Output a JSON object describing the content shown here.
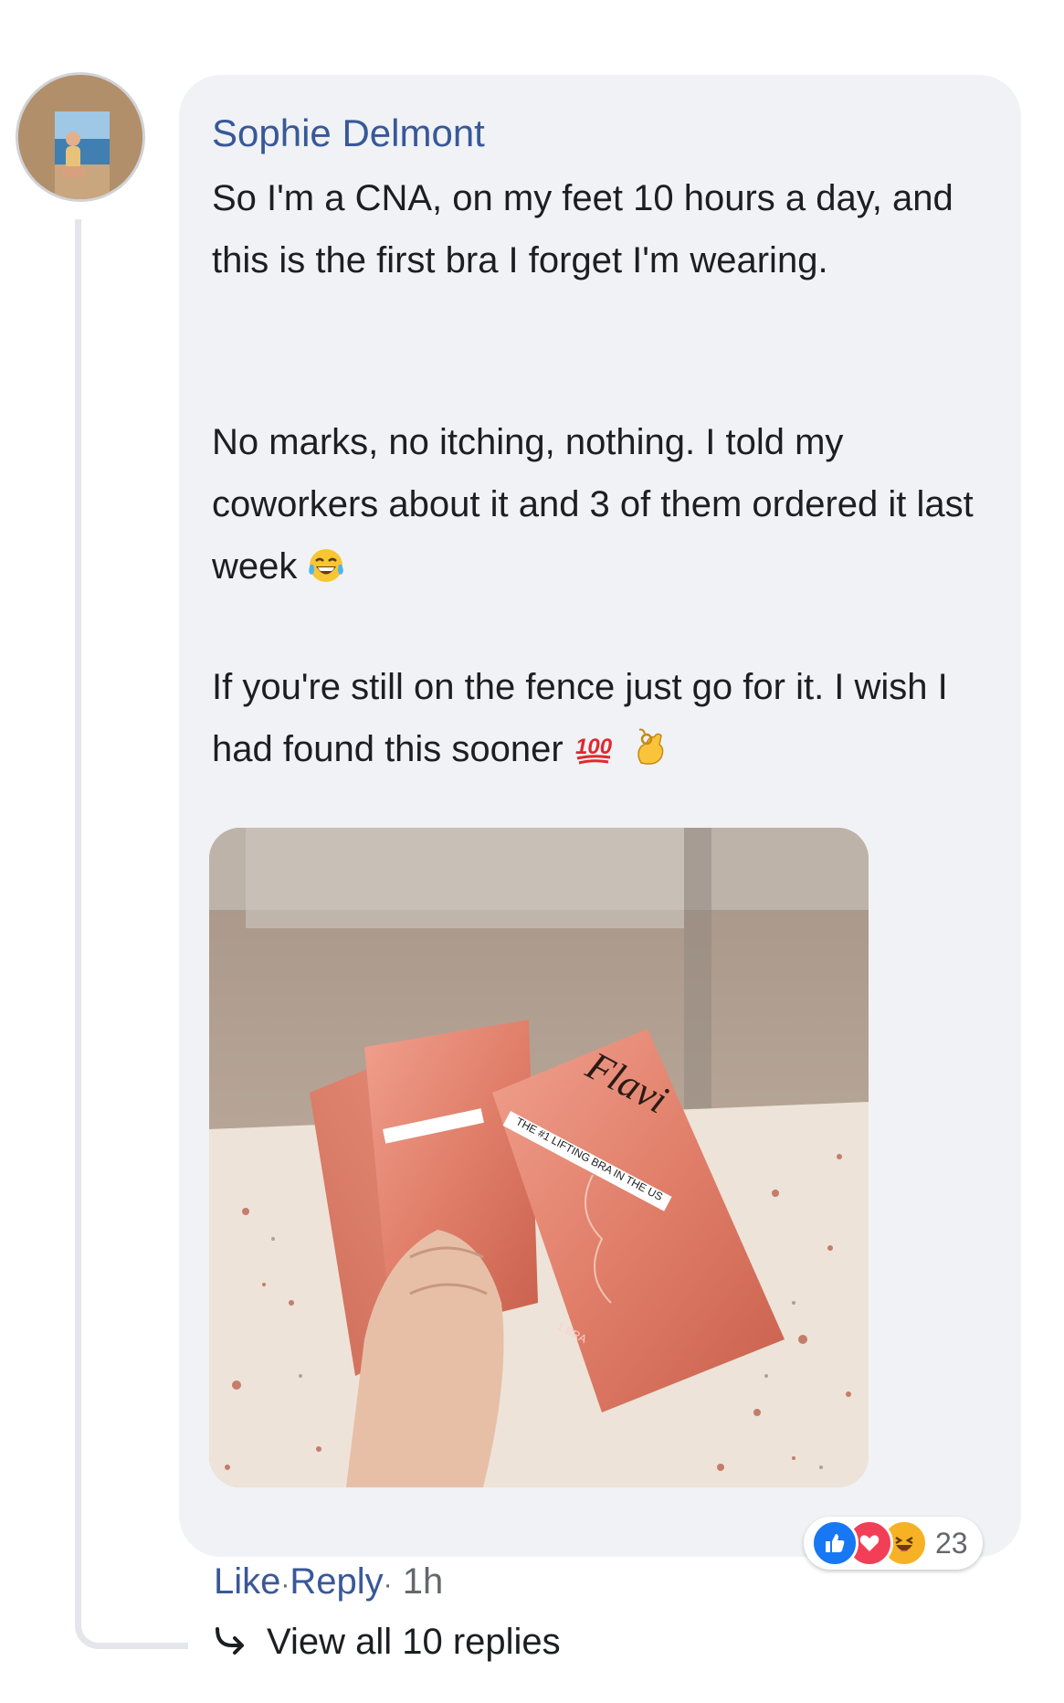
{
  "comment": {
    "author": "Sophie Delmont",
    "paragraphs": [
      "So I'm a CNA, on my feet 10 hours a day, and this is the first bra I forget I'm wearing.",
      "No marks, no itching, nothing. I told my coworkers about it and 3 of them ordered it last week",
      "If you're still on the fence just go for it. I wish I had found this sooner"
    ],
    "emojis": [
      "laughing-tears-emoji",
      "hundred-points-emoji",
      "ok-hand-emoji"
    ]
  },
  "photo": {
    "brand": "Flavi",
    "tagline": "THE #1 LIFTING BRA IN THE US",
    "count_label": "1 BRA"
  },
  "reactions": {
    "icons": [
      "like-icon",
      "love-icon",
      "haha-icon"
    ],
    "count": "23"
  },
  "actions": {
    "like": "Like",
    "reply": "Reply",
    "separator": "·",
    "time": "1h"
  },
  "replies": {
    "label": "View all 10 replies"
  },
  "colors": {
    "bubble": "#f0f2f5",
    "link": "#385898",
    "like": "#1877f2",
    "love": "#f33e58",
    "haha": "#f7b125",
    "pouch": "#e58a76"
  }
}
